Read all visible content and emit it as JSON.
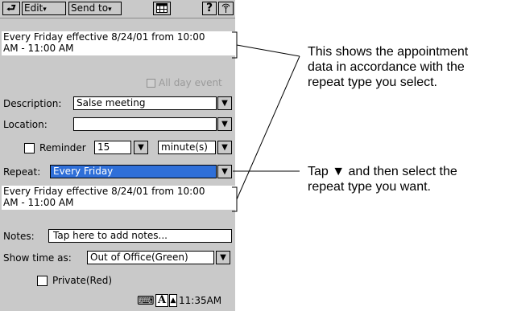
{
  "toolbar": {
    "undo_icon": "undo-arrow-icon",
    "edit_label": "Edit",
    "send_label": "Send to",
    "calendar_icon": "calendar-icon",
    "help_label": "?",
    "signal_icon": "antenna-icon",
    "caret": "▾"
  },
  "summary_top": "Every Friday effective 8/24/01 from 10:00\nAM - 11:00 AM",
  "all_day": {
    "label": "All day event",
    "checked": false,
    "enabled": false
  },
  "description": {
    "label": "Description:",
    "value": "Salse meeting"
  },
  "location": {
    "label": "Location:",
    "value": ""
  },
  "reminder": {
    "label": "Reminder",
    "checked": false,
    "amount": "15",
    "unit": "minute(s)"
  },
  "repeat": {
    "label": "Repeat:",
    "value": "Every Friday"
  },
  "summary_bottom": "Every Friday effective 8/24/01 from 10:00\nAM - 11:00 AM",
  "notes": {
    "label": "Notes:",
    "placeholder": "Tap here to add notes..."
  },
  "show_time_as": {
    "label": "Show time as:",
    "value": "Out of Office(Green)"
  },
  "private": {
    "label": "Private(Red)",
    "checked": false
  },
  "statusbar": {
    "keyboard_icon": "keyboard-icon",
    "input_label": "A",
    "arrow": "▲",
    "time": "11:35AM"
  },
  "dropdown_glyph": "▼",
  "callouts": {
    "summary_note": "This shows the appointment\ndata in accordance with the\nrepeat type you select.",
    "repeat_note": "Tap ▼ and then select the\nrepeat type you want."
  },
  "colors": {
    "screen_bg": "#c9c9c9",
    "selection": "#2f6fd8"
  }
}
